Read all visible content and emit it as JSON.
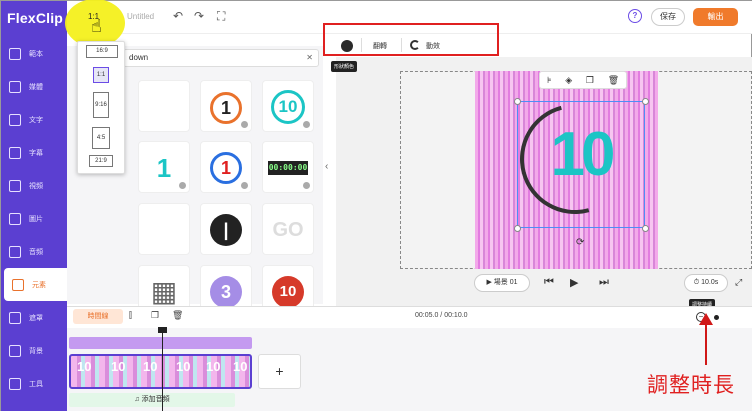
{
  "app": {
    "logo": "FlexClip",
    "title": "Untitled"
  },
  "sidebar": {
    "items": [
      {
        "label": "範本",
        "icon": "template-icon"
      },
      {
        "label": "媒體",
        "icon": "media-icon"
      },
      {
        "label": "文字",
        "icon": "text-icon"
      },
      {
        "label": "字幕",
        "icon": "subtitle-icon"
      },
      {
        "label": "視頻",
        "icon": "video-icon"
      },
      {
        "label": "圖片",
        "icon": "image-icon"
      },
      {
        "label": "音頻",
        "icon": "audio-icon"
      },
      {
        "label": "元素",
        "icon": "element-icon"
      },
      {
        "label": "遮罩",
        "icon": "mask-icon"
      },
      {
        "label": "背景",
        "icon": "background-icon"
      },
      {
        "label": "工具",
        "icon": "tools-icon"
      }
    ]
  },
  "topbar": {
    "ratio": "1:1",
    "save": "保存",
    "export": "輸出"
  },
  "ratio_menu": {
    "options": [
      "16:9",
      "1:1",
      "9:16",
      "4:5",
      "21:9"
    ],
    "selected": "1:1"
  },
  "panel": {
    "search_value": "down"
  },
  "toolbar": {
    "color_tooltip": "形狀顏色",
    "flip": "翻轉",
    "animation": "動效"
  },
  "playback": {
    "scene": "場景 01",
    "duration": "10.0s",
    "duration_tooltip": "調整持續"
  },
  "timeline": {
    "label": "時間線",
    "time": "00:05.0 / 00:10.0",
    "add_music": "添加音頻",
    "clip_nums": [
      "10",
      "10",
      "10",
      "10",
      "10",
      "10"
    ]
  },
  "canvas": {
    "number": "10"
  },
  "annotation": {
    "text": "調整時長"
  },
  "colors": {
    "brand": "#5b3fd1",
    "accent": "#f07a2b",
    "highlight": "#f4f01c",
    "annotation": "#e02020"
  }
}
